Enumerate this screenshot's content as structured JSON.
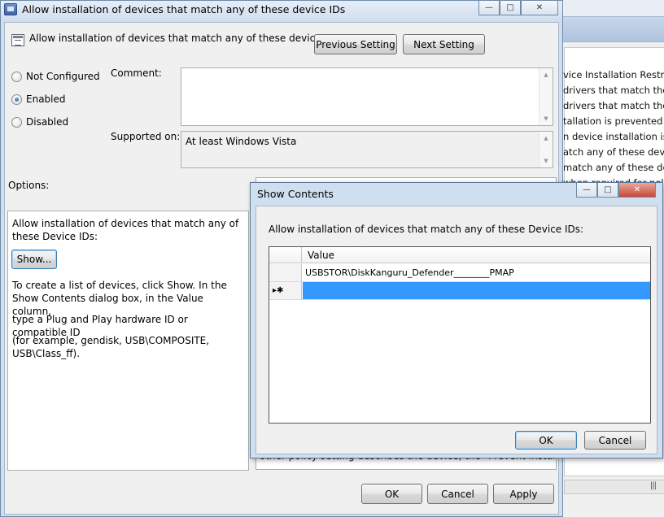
{
  "main_window": {
    "title": "Allow installation of devices that match any of these device IDs",
    "header_title": "Allow installation of devices that match any of these device IDs",
    "previous_setting": "Previous Setting",
    "next_setting": "Next Setting",
    "radio_options": [
      {
        "label": "Not Configured",
        "checked": false
      },
      {
        "label": "Enabled",
        "checked": true
      },
      {
        "label": "Disabled",
        "checked": false
      }
    ],
    "comment_label": "Comment:",
    "supported_on_label": "Supported on:",
    "supported_on_value": "At least Windows Vista",
    "options_label": "Options:",
    "options_panel": {
      "description": "Allow installation of devices that match any of these Device IDs:",
      "show_button": "Show...",
      "help_1": "To create a list of devices, click Show. In the Show Contents dialog box, in the Value column,",
      "help_2": "type a Plug and Play hardware ID or compatible ID",
      "help_3": "(for example, gendisk, USB\\COMPOSITE, USB\\Class_ff)."
    },
    "help_cut_text": "other policy setting describes the device, the \"Prevent installation",
    "ok": "OK",
    "cancel": "Cancel",
    "apply": "Apply"
  },
  "background_window": {
    "lines": [
      "vice Installation Restrict",
      "drivers that match these",
      "drivers that match the",
      "tallation is prevented b",
      "n device installation is p",
      "atch any of these device",
      "match any of these dev",
      "when required for policy"
    ],
    "scroll_grip": "|||"
  },
  "dialog": {
    "title": "Show Contents",
    "prompt": "Allow installation of devices that match any of these Device IDs:",
    "column_header": "Value",
    "rows": [
      {
        "marker": "",
        "value": "USBSTOR\\DiskKanguru_Defender________PMAP",
        "selected": false
      },
      {
        "marker": "▸✱",
        "value": "",
        "selected": true
      }
    ],
    "ok": "OK",
    "cancel": "Cancel"
  },
  "colors": {
    "selection": "#3399ff",
    "window_frame": "#cfdff0",
    "client": "#f0f0f0"
  }
}
